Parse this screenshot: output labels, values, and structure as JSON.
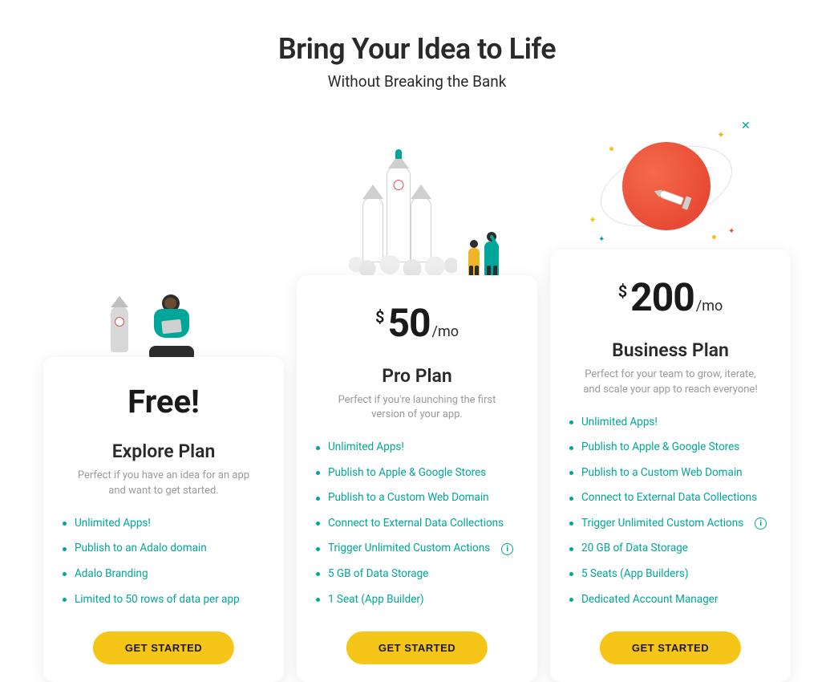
{
  "hero": {
    "title": "Bring Your Idea to Life",
    "subtitle": "Without Breaking the Bank"
  },
  "colors": {
    "accent_teal": "#00a699",
    "cta_yellow": "#f5c518",
    "planet_red": "#e84b35"
  },
  "plans": [
    {
      "id": "explore",
      "price_free_label": "Free!",
      "currency_symbol": "",
      "amount": "",
      "period": "",
      "name": "Explore Plan",
      "description": "Perfect if you have an idea for an app and want to get started.",
      "features": [
        {
          "label": "Unlimited Apps!",
          "info": false
        },
        {
          "label": "Publish to an Adalo domain",
          "info": false
        },
        {
          "label": "Adalo Branding",
          "info": false
        },
        {
          "label": "Limited to 50 rows of data per app",
          "info": false
        }
      ],
      "cta": "GET STARTED"
    },
    {
      "id": "pro",
      "price_free_label": "",
      "currency_symbol": "$",
      "amount": "50",
      "period": "/mo",
      "name": "Pro Plan",
      "description": "Perfect if you're launching the first version of your app.",
      "features": [
        {
          "label": "Unlimited Apps!",
          "info": false
        },
        {
          "label": "Publish to Apple & Google Stores",
          "info": false
        },
        {
          "label": "Publish to a Custom Web Domain",
          "info": false
        },
        {
          "label": "Connect to External Data Collections",
          "info": false
        },
        {
          "label": "Trigger Unlimited Custom Actions",
          "info": true
        },
        {
          "label": "5 GB of Data Storage",
          "info": false
        },
        {
          "label": "1 Seat (App Builder)",
          "info": false
        }
      ],
      "cta": "GET STARTED"
    },
    {
      "id": "business",
      "price_free_label": "",
      "currency_symbol": "$",
      "amount": "200",
      "period": "/mo",
      "name": "Business Plan",
      "description": "Perfect for your team to grow, iterate, and scale your app to reach everyone!",
      "features": [
        {
          "label": "Unlimited Apps!",
          "info": false
        },
        {
          "label": "Publish to Apple & Google Stores",
          "info": false
        },
        {
          "label": "Publish to a Custom Web Domain",
          "info": false
        },
        {
          "label": "Connect to External Data Collections",
          "info": false
        },
        {
          "label": "Trigger Unlimited Custom Actions",
          "info": true
        },
        {
          "label": "20 GB of Data Storage",
          "info": false
        },
        {
          "label": "5 Seats (App Builders)",
          "info": false
        },
        {
          "label": "Dedicated Account Manager",
          "info": false
        }
      ],
      "cta": "GET STARTED"
    }
  ]
}
